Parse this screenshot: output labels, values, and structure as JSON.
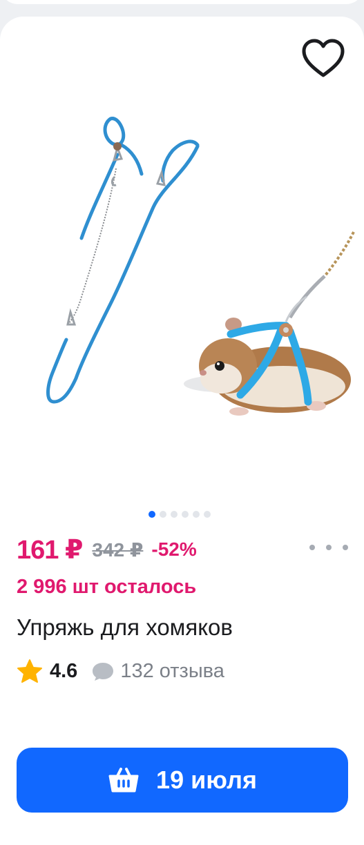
{
  "product": {
    "price": "161 ₽",
    "old_price": "342 ₽",
    "discount": "-52%",
    "stock_left": "2 996 шт осталось",
    "title": "Упряжь для хомяков",
    "rating": "4.6",
    "reviews": "132 отзыва",
    "image_count": 6,
    "active_image_index": 0
  },
  "actions": {
    "delivery_label": "19 июля",
    "favorite_icon": "heart-icon",
    "more_icon": "more-dots-icon",
    "cart_icon": "basket-icon"
  },
  "colors": {
    "accent_blue": "#1168ff",
    "price_pink": "#e0196e",
    "star_yellow": "#ffb300"
  }
}
